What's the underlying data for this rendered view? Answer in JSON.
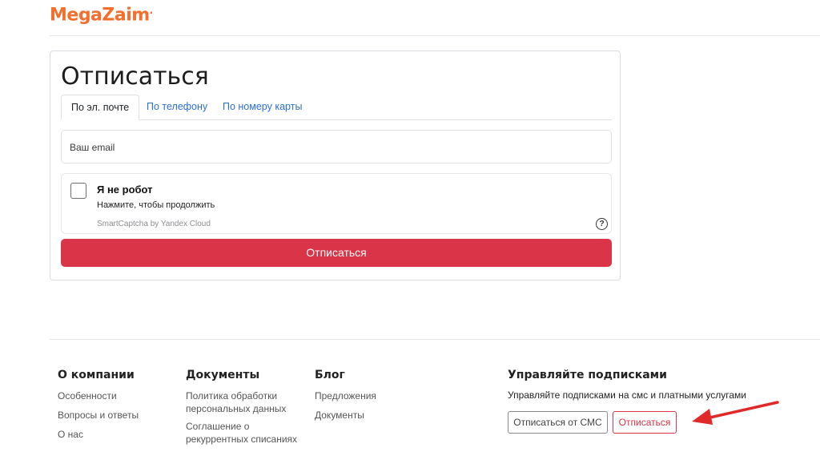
{
  "header": {
    "logo_text": "MegaZaim",
    "logo_dot": "."
  },
  "card": {
    "title": "Отписаться",
    "tabs": [
      {
        "label": "По эл. почте",
        "active": true
      },
      {
        "label": "По телефону",
        "active": false
      },
      {
        "label": "По номеру карты",
        "active": false
      }
    ],
    "email": {
      "placeholder": "Ваш email",
      "value": ""
    },
    "captcha": {
      "checked": false,
      "title": "Я не робот",
      "subtitle": "Нажмите, чтобы продолжить",
      "brand": "SmartCaptcha by Yandex Cloud",
      "help_symbol": "?"
    },
    "submit_label": "Отписаться"
  },
  "footer": {
    "company": {
      "heading": "О компании",
      "links": [
        "Особенности",
        "Вопросы и ответы",
        "О нас"
      ]
    },
    "documents": {
      "heading": "Документы",
      "links": [
        "Политика обработки персональных данных",
        "Соглашение о рекуррентных списаниях"
      ]
    },
    "blog": {
      "heading": "Блог",
      "links": [
        "Предложения",
        "Документы"
      ]
    },
    "subscriptions": {
      "heading": "Управляйте подписками",
      "description": "Управляйте подписками на смс и платными услугами",
      "sms_button": "Отписаться от СМС",
      "unsubscribe_button": "Отписаться"
    }
  },
  "colors": {
    "brand_orange": "#f36f2e",
    "accent_red": "#d93447",
    "link_blue": "#2a6fd6"
  }
}
